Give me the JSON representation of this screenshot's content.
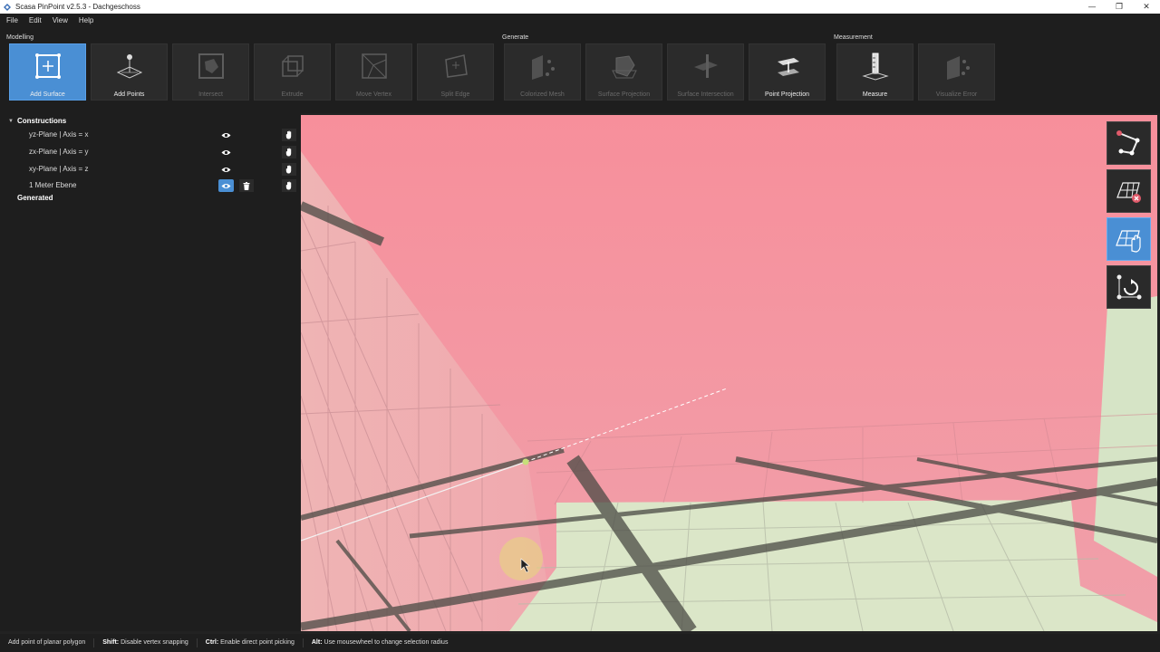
{
  "window": {
    "title": "Scasa PinPoint v2.5.3 - Dachgeschoss",
    "controls": [
      "—",
      "❐",
      "✕"
    ]
  },
  "menu": [
    "File",
    "Edit",
    "View",
    "Help"
  ],
  "toolbar": {
    "groups": {
      "modelling": "Modelling",
      "generate": "Generate",
      "measurement": "Measurement"
    },
    "tools": [
      {
        "label": "Add Surface",
        "state": "active"
      },
      {
        "label": "Add Points",
        "state": "enabled"
      },
      {
        "label": "Intersect",
        "state": "disabled"
      },
      {
        "label": "Extrude",
        "state": "disabled"
      },
      {
        "label": "Move Vertex",
        "state": "disabled"
      },
      {
        "label": "Split Edge",
        "state": "disabled"
      },
      {
        "label": "Colorized Mesh",
        "state": "disabled"
      },
      {
        "label": "Surface Projection",
        "state": "disabled"
      },
      {
        "label": "Surface Intersection",
        "state": "disabled"
      },
      {
        "label": "Point Projection",
        "state": "enabled"
      },
      {
        "label": "Measure",
        "state": "enabled"
      },
      {
        "label": "Visualize Error",
        "state": "disabled"
      }
    ]
  },
  "sidebar": {
    "constructions_label": "Constructions",
    "items": [
      {
        "label": "yz-Plane | Axis = x",
        "visible_active": false,
        "deletable": false
      },
      {
        "label": "zx-Plane | Axis = y",
        "visible_active": false,
        "deletable": false
      },
      {
        "label": "xy-Plane | Axis = z",
        "visible_active": false,
        "deletable": false
      },
      {
        "label": "1 Meter Ebene",
        "visible_active": true,
        "deletable": true
      }
    ],
    "generated_label": "Generated"
  },
  "viewport_tools": [
    {
      "name": "polygon-vertex-icon",
      "active": false
    },
    {
      "name": "grid-remove-icon",
      "active": false
    },
    {
      "name": "grid-hand-icon",
      "active": true
    },
    {
      "name": "rotate-points-icon",
      "active": false
    }
  ],
  "status": {
    "hint": "Add point of planar polygon",
    "shift_key": "Shift:",
    "shift_text": "Disable vertex snapping",
    "ctrl_key": "Ctrl:",
    "ctrl_text": "Enable direct point picking",
    "alt_key": "Alt:",
    "alt_text": "Use mousewheel to change selection radius"
  },
  "colors": {
    "accent": "#4a8fd4",
    "panel": "#1e1e1e",
    "surface_pink": "#f4a3ad",
    "floor_green": "#dbe6c8"
  }
}
